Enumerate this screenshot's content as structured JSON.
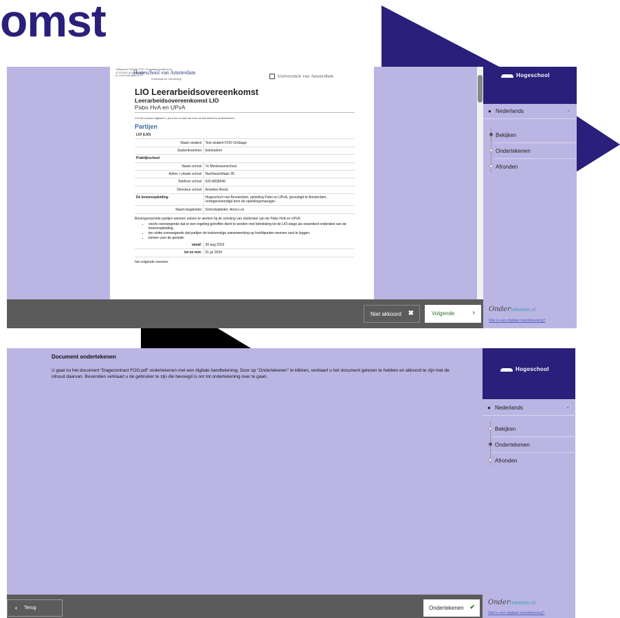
{
  "heading": "omst",
  "colors": {
    "brand": "#2a1f7a",
    "panel_bg": "#bbb5e4",
    "footer_bg": "#5b5b5b",
    "next_green": "#2a7a2a"
  },
  "sidebar": {
    "brand_name": "Hogeschool",
    "language": "Nederlands",
    "steps": [
      "Bekijken",
      "Ondertekenen",
      "Afronden"
    ],
    "signing_logo_main": "Onder",
    "signing_logo_accent": "tekenen.nl",
    "help_link": "Wat is een digitale handtekening?"
  },
  "document": {
    "header_lines": "Todaycount OnStage FOO <Todaystage.foo@hva.nl>\n07/10/2023 10:44:18 CEST\nID: a7cb7948-b880-4e",
    "hva_logo": "Hogeschool van Amsterdam",
    "hva_sub": "Onderwijs en Opvoeding",
    "uva_logo": "Universiteit van Amsterdam",
    "title": "LIO Leerarbeidsovereenkomst",
    "subtitle": "Leerarbeidsovereenkomst LIO",
    "parties_line": "Pabo HvA en UPvA",
    "instruction": "Vul het contract digitaal in, print het en laat het door de betrokkenen ondertekenen.",
    "section": "Partijen",
    "rows": [
      {
        "label": "LIO (LIO)",
        "value": "",
        "type": "group"
      },
      {
        "label": "Naam student",
        "value": "Test student FOO OnStage",
        "type": "field"
      },
      {
        "label": "Studentnummer",
        "value": "teststudent",
        "type": "field"
      },
      {
        "label": "Praktijkschool",
        "value": "",
        "type": "group"
      },
      {
        "label": "Naam school",
        "value": "7e Montessorischool",
        "type": "field"
      },
      {
        "label": "Adres + plaats school",
        "value": "Nachtwachtlaan 35",
        "type": "field"
      },
      {
        "label": "Telefoon school",
        "value": "020-6836646",
        "type": "field"
      },
      {
        "label": "Directeur school",
        "value": "Annelies Boots",
        "type": "field"
      },
      {
        "label": "De lerarenopleiding",
        "value": "Hogeschool van Amsterdam, opleiding Pabo en UPvA, gevestigd te Amsterdam, vertegenwoordigd door de opleidingsmanager.",
        "type": "group-value"
      },
      {
        "label": "Naam begeleider",
        "value": "Schoolopleider: Anna Los",
        "type": "field"
      }
    ],
    "intro": "Bovengenoemde partijen wensen samen te werken bij de scholing van studenten van de Pabo HvA en UPvA",
    "bullets": [
      "voorts overwegende dat er een regeling getroffen dient te worden met betrekking tot de LIO-stage als essentieel onderdeel van de lerarenopleiding,",
      "ten slotte overwegende dat partijen de toekomstige samenwerking op hoofdpunten wensen vast te leggen,",
      "komen voor de periode:"
    ],
    "period": [
      {
        "label": "vanaf:",
        "value": "30 aug 2023"
      },
      {
        "label": "tot en met:",
        "value": "31 jul 2024"
      }
    ],
    "closing": "het volgende overeen:"
  },
  "panel1": {
    "disagree_label": "Niet akkoord",
    "next_label": "Volgende"
  },
  "panel2": {
    "title": "Document ondertekenen",
    "text": "U gaat nu het document 'Stagecontract FOO.pdf' ondertekenen met een digitale handtekening. Door op \"Ondertekenen\" te klikken, verklaart u het document gelezen te hebben en akkoord te zijn met de inhoud daarvan. Bovendien verklaart u de gebruiker te zijn die bevoegd is om tot ondertekening over te gaan.",
    "back_label": "Terug",
    "sign_label": "Ondertekenen"
  }
}
